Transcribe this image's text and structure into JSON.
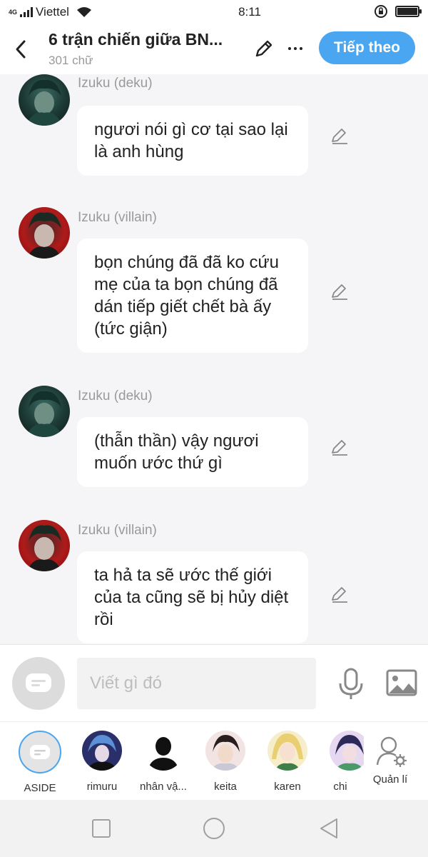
{
  "status": {
    "network": "4G",
    "carrier": "Viettel",
    "time": "8:11"
  },
  "header": {
    "title": "6 trận chiến giữa BN...",
    "word_count": "301 chữ",
    "next_label": "Tiếp theo",
    "accent_color": "#4aa6f0"
  },
  "messages": [
    {
      "sender": "Izuku (deku)",
      "text": "ngươi nói gì cơ tại sao lại là anh hùng",
      "avatar": "deku-avatar"
    },
    {
      "sender": "Izuku (villain)",
      "text": "bọn chúng đã đã ko cứu mẹ của ta bọn chúng đã dán tiếp giết chết bà ấy (tức giận)",
      "avatar": "villain-avatar"
    },
    {
      "sender": "Izuku (deku)",
      "text": "(thẫn thần) vậy ngươi muốn ước thứ gì",
      "avatar": "deku-avatar"
    },
    {
      "sender": "Izuku (villain)",
      "text": "ta hả ta sẽ ước thế giới của ta cũng sẽ bị hủy diệt rồi",
      "avatar": "villain-avatar"
    }
  ],
  "composer": {
    "placeholder": "Viết gì đó"
  },
  "characters": [
    {
      "name": "ASIDE"
    },
    {
      "name": "rimuru"
    },
    {
      "name": "nhân vậ..."
    },
    {
      "name": "keita"
    },
    {
      "name": "karen"
    },
    {
      "name": "chi"
    },
    {
      "name": "Quản lí"
    }
  ]
}
